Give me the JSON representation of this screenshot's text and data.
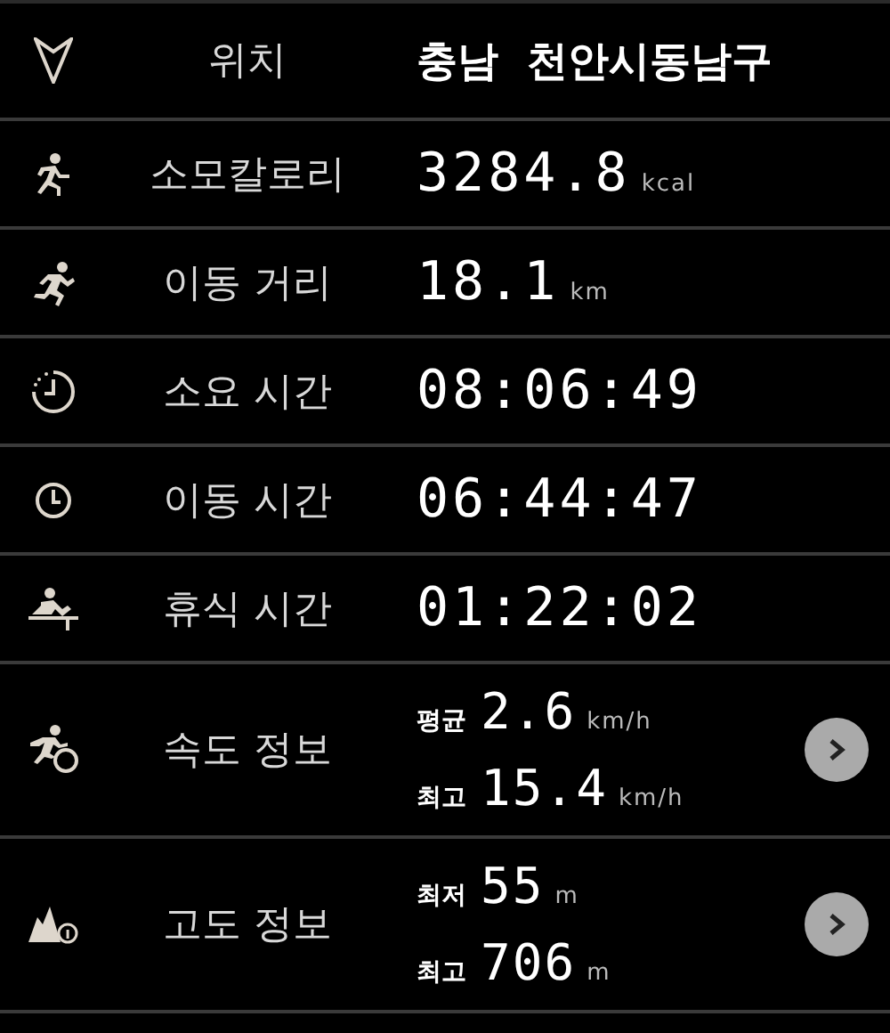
{
  "rows": [
    {
      "kind": "location",
      "label": "위치",
      "value": "충남  천안시동남구"
    },
    {
      "kind": "single",
      "label": "소모칼로리",
      "value": "3284.8",
      "unit": "kcal"
    },
    {
      "kind": "single",
      "label": "이동 거리",
      "value": "18.1",
      "unit": "km"
    },
    {
      "kind": "single",
      "label": "소요 시간",
      "value": "08:06:49"
    },
    {
      "kind": "single",
      "label": "이동 시간",
      "value": "06:44:47"
    },
    {
      "kind": "single",
      "label": "휴식 시간",
      "value": "01:22:02"
    },
    {
      "kind": "pair",
      "label": "속도 정보",
      "lines": [
        {
          "prefix": "평균",
          "value": "2.6",
          "unit": "km/h"
        },
        {
          "prefix": "최고",
          "value": "15.4",
          "unit": "km/h"
        }
      ]
    },
    {
      "kind": "pair",
      "label": "고도 정보",
      "lines": [
        {
          "prefix": "최저",
          "value": "55",
          "unit": "m"
        },
        {
          "prefix": "최고",
          "value": "706",
          "unit": "m"
        }
      ]
    }
  ]
}
